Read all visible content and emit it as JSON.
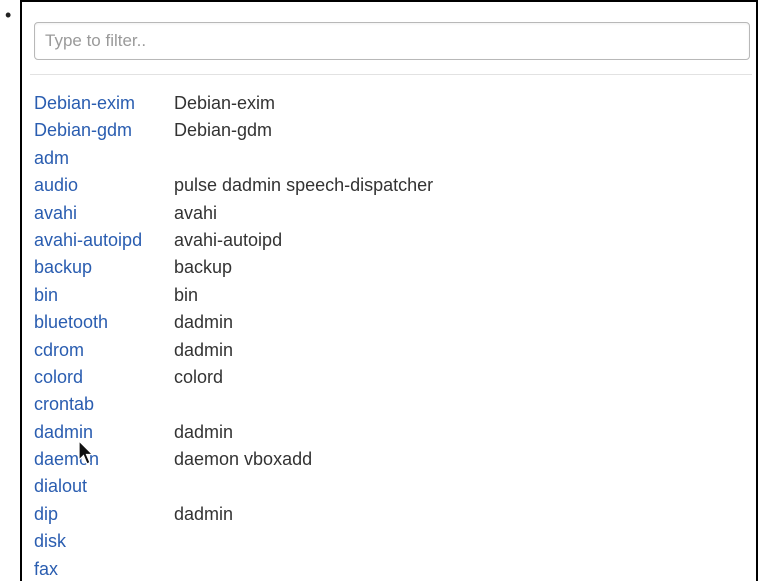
{
  "filter": {
    "placeholder": "Type to filter.."
  },
  "groups": [
    {
      "name": "Debian-exim",
      "members": "Debian-exim"
    },
    {
      "name": "Debian-gdm",
      "members": "Debian-gdm"
    },
    {
      "name": "adm",
      "members": ""
    },
    {
      "name": "audio",
      "members": "pulse dadmin speech-dispatcher"
    },
    {
      "name": "avahi",
      "members": "avahi"
    },
    {
      "name": "avahi-autoipd",
      "members": "avahi-autoipd"
    },
    {
      "name": "backup",
      "members": "backup"
    },
    {
      "name": "bin",
      "members": "bin"
    },
    {
      "name": "bluetooth",
      "members": "dadmin"
    },
    {
      "name": "cdrom",
      "members": "dadmin"
    },
    {
      "name": "colord",
      "members": "colord"
    },
    {
      "name": "crontab",
      "members": ""
    },
    {
      "name": "dadmin",
      "members": "dadmin"
    },
    {
      "name": "daemon",
      "members": "daemon vboxadd"
    },
    {
      "name": "dialout",
      "members": ""
    },
    {
      "name": "dip",
      "members": "dadmin"
    },
    {
      "name": "disk",
      "members": ""
    },
    {
      "name": "fax",
      "members": ""
    }
  ],
  "colors": {
    "link": "#2a5db0",
    "text": "#333333"
  }
}
